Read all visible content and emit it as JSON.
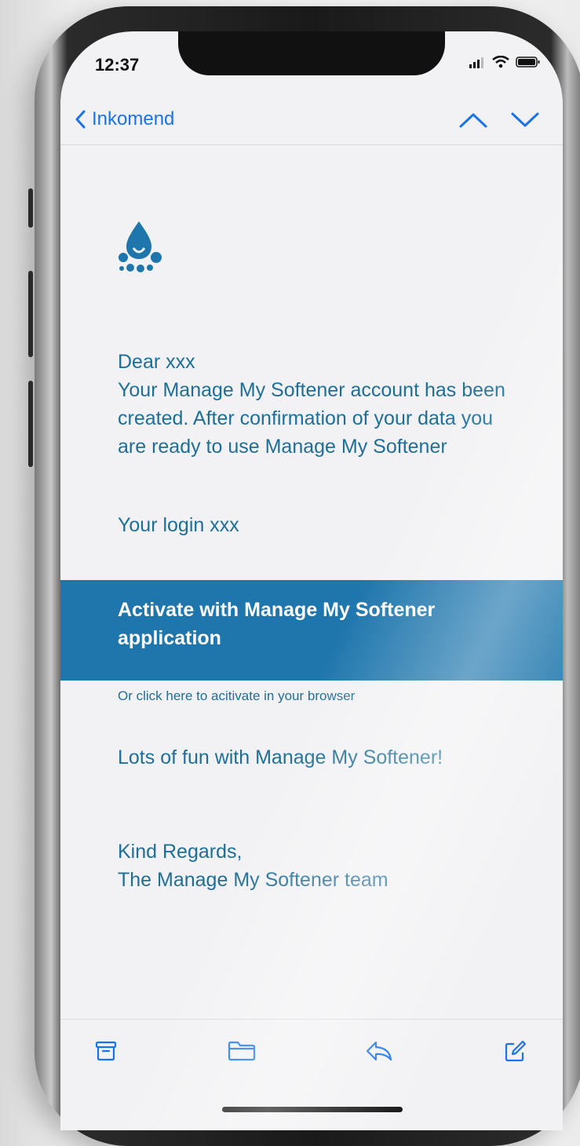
{
  "status_bar": {
    "time": "12:37"
  },
  "nav": {
    "back_label": "Inkomend"
  },
  "email": {
    "greeting": "Dear xxx",
    "body": "Your Manage My Softener account has been created. After confirmation of your data you are ready to use Manage My Softener",
    "login_line": "Your login xxx",
    "cta_label": "Activate with Manage My Softener application",
    "browser_link": "Or click here to acitivate in your browser",
    "fun_line": "Lots of fun with Manage My Softener!",
    "regards": "Kind Regards,",
    "signature": "The Manage My Softener team"
  },
  "toolbar": {
    "icons": [
      "archive-icon",
      "folder-icon",
      "reply-icon",
      "compose-icon"
    ]
  },
  "colors": {
    "accent_link": "#1a73e8",
    "text_teal": "#1f6e96",
    "cta_bg": "#1e76ad",
    "screen_bg": "#f2f2f4"
  }
}
